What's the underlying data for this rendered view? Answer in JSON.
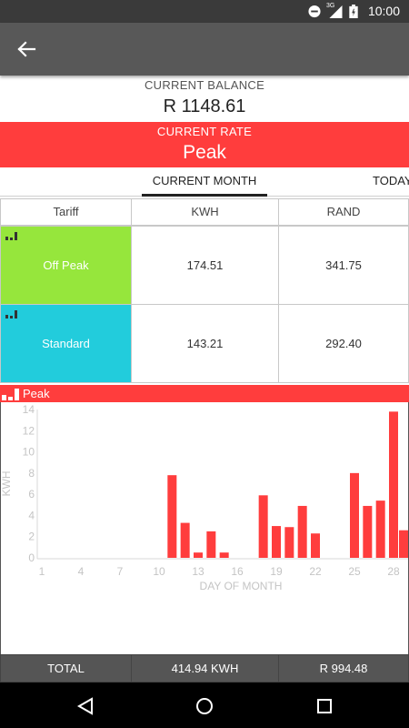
{
  "status_bar": {
    "time": "10:00",
    "network": "3G",
    "icons": [
      "do-not-disturb-icon",
      "signal-icon",
      "battery-icon"
    ]
  },
  "app_bar": {
    "back_icon": "arrow-left-icon"
  },
  "balance": {
    "label": "CURRENT BALANCE",
    "value": "R 1148.61"
  },
  "rate": {
    "label": "CURRENT RATE",
    "value": "Peak",
    "color": "#ff3d3d"
  },
  "tabs": [
    {
      "label": "CURRENT MONTH",
      "selected": true
    },
    {
      "label": "TODAY",
      "selected": false
    }
  ],
  "table": {
    "headers": [
      "Tariff",
      "KWH",
      "RAND"
    ],
    "rows": [
      {
        "tariff": "Off Peak",
        "kwh": "174.51",
        "rand": "341.75",
        "color": "#96e63c"
      },
      {
        "tariff": "Standard",
        "kwh": "143.21",
        "rand": "292.40",
        "color": "#22ccdc"
      }
    ]
  },
  "peak_banner": {
    "label": "Peak",
    "color": "#ff3d3d"
  },
  "chart_data": {
    "type": "bar",
    "xlabel": "DAY OF MONTH",
    "ylabel": "KWH",
    "xlim": [
      1,
      28
    ],
    "ylim": [
      0,
      14
    ],
    "x_ticks": [
      1,
      4,
      7,
      10,
      13,
      16,
      19,
      22,
      25,
      28
    ],
    "y_ticks": [
      0,
      2,
      4,
      6,
      8,
      10,
      12,
      14
    ],
    "bar_color": "#ff3d3d",
    "grid": false,
    "x": [
      11,
      12,
      13,
      14,
      15,
      18,
      19,
      20,
      21,
      22,
      25,
      26,
      27,
      28,
      29
    ],
    "values": [
      7.8,
      3.3,
      0.5,
      2.5,
      0.5,
      5.9,
      3.0,
      2.9,
      4.9,
      2.3,
      8.0,
      4.9,
      5.4,
      13.8,
      2.6
    ]
  },
  "totals": {
    "label": "TOTAL",
    "kwh": "414.94 KWH",
    "rand": "R 994.48"
  },
  "nav_bar": {
    "icons": [
      "back-triangle-icon",
      "home-circle-icon",
      "recents-square-icon"
    ]
  }
}
